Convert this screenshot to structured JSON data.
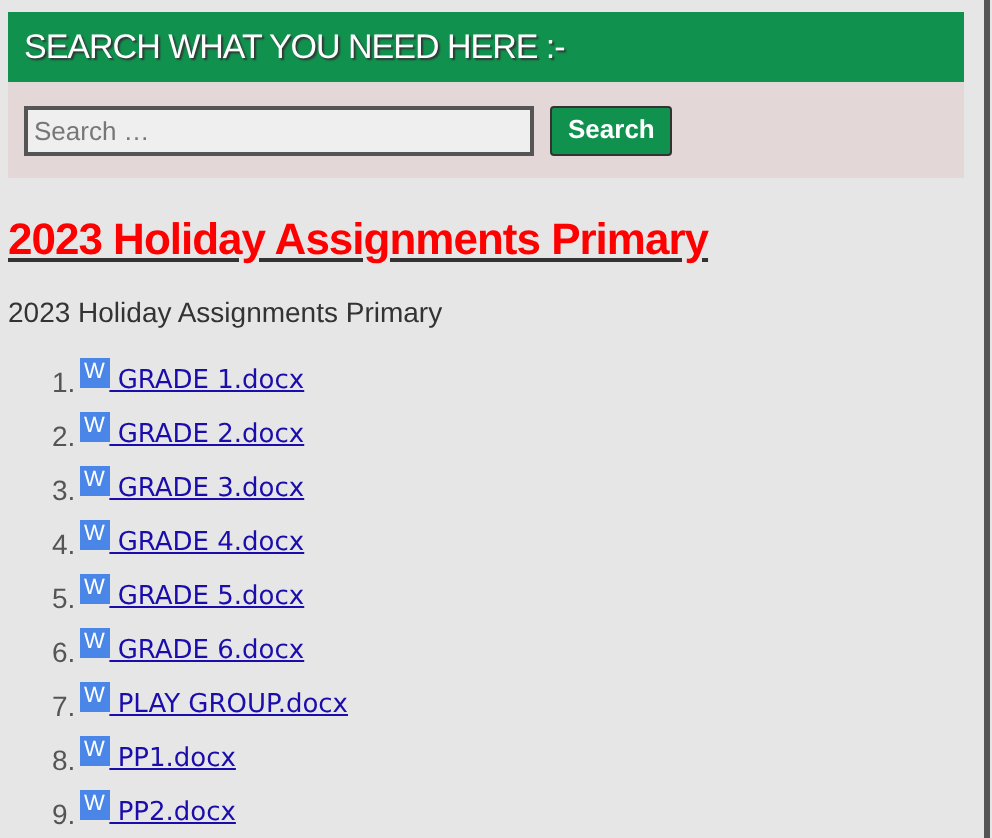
{
  "search_widget": {
    "heading": "SEARCH WHAT YOU NEED HERE :-",
    "placeholder": "Search …",
    "button": "Search"
  },
  "post": {
    "title": "2023 Holiday Assignments Primary",
    "intro": "2023 Holiday Assignments Primary",
    "files": [
      {
        "number": "1.",
        "icon_letter": "W",
        "name": " GRADE 1.docx"
      },
      {
        "number": "2.",
        "icon_letter": "W",
        "name": " GRADE 2.docx"
      },
      {
        "number": "3.",
        "icon_letter": "W",
        "name": " GRADE 3.docx"
      },
      {
        "number": "4.",
        "icon_letter": "W",
        "name": " GRADE 4.docx"
      },
      {
        "number": "5.",
        "icon_letter": "W",
        "name": " GRADE 5.docx"
      },
      {
        "number": "6.",
        "icon_letter": "W",
        "name": " GRADE 6.docx"
      },
      {
        "number": "7.",
        "icon_letter": "W",
        "name": " PLAY GROUP.docx"
      },
      {
        "number": "8.",
        "icon_letter": "W",
        "name": " PP1.docx"
      },
      {
        "number": "9.",
        "icon_letter": "W",
        "name": " PP2.docx"
      }
    ]
  }
}
